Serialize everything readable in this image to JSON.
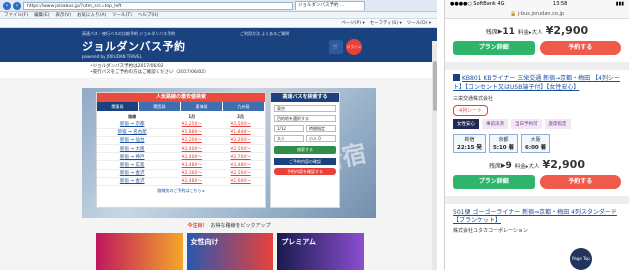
{
  "desktop": {
    "browser": {
      "address": "https://www.jolsabus.jp/?utm_src=top_left",
      "tab_label": "ジョルダンバス予約 ...",
      "menus": [
        "ファイル(F)",
        "編集(E)",
        "表示(V)",
        "お気に入り(A)",
        "ツール(T)",
        "ヘルプ(H)"
      ],
      "commands": [
        "ページ(P) ▾",
        "セーフティ(S) ▾",
        "ツール(O) ▾"
      ]
    },
    "site": {
      "topline": "高速バス・夜行バスの比較予約 ジョルダンバス予約",
      "toplinks": "ご利用方法   よくあるご質問",
      "logo": "ジョルダンバス予約",
      "logo_sub": "powered by JORUDAN TRAVEL",
      "cart": "🛒",
      "login": "ログイン",
      "notices": [
        "ジョルダンバス予約は2017/06/02",
        "夜行バスをご予約の方はご確認ください（2017/06/02）"
      ]
    },
    "hero_text": "新宿",
    "ranking": {
      "title": "人気路線の最安値検索",
      "tabs": [
        "関東発",
        "関西発",
        "東海発",
        "九州発"
      ],
      "headers": [
        "路線",
        "1月",
        "2月"
      ],
      "rows": [
        [
          "新宿 ⇒ 京都",
          "¥2,250〜",
          "¥2,500〜"
        ],
        [
          "新宿 ⇒ 名古屋",
          "¥1,880〜",
          "¥1,848〜"
        ],
        [
          "新宿 ⇒ 仙台",
          "¥2,200〜",
          "¥2,200〜"
        ],
        [
          "新宿 ⇒ 大阪",
          "¥2,400〜",
          "¥2,500〜"
        ],
        [
          "新宿 ⇒ 神戸",
          "¥2,400〜",
          "¥2,700〜"
        ],
        [
          "新宿 ⇒ 広島",
          "¥3,480〜",
          "¥3,480〜"
        ],
        [
          "新宿 ⇒ 金沢",
          "¥2,360〜",
          "¥2,500〜"
        ],
        [
          "新宿 ⇒ 金沢",
          "¥2,480〜",
          "¥2,600〜"
        ]
      ],
      "more": "路線別のご予約はこちら ▸"
    },
    "search": {
      "title": "高速バスを検索する",
      "from": "東京",
      "to": "目的地を選択する",
      "date": "1/12",
      "time": "時間指定",
      "adults": "大人",
      "children": "小人 0",
      "button": "検索する",
      "link1": "ご予約内容の確認",
      "link2": "予約内容を確認する"
    },
    "pickup": {
      "badge": "今注目！",
      "text": "お得な路線をピックアップ"
    },
    "banners": [
      "",
      "女性向け",
      "プレミアム"
    ]
  },
  "mobile": {
    "status": {
      "carrier": "●●●●○ SoftBank  4G",
      "time": "13:58",
      "battery": "▮▮▮"
    },
    "url": "🔒 j-bus.jorudan.co.jp",
    "card1": {
      "remain_label": "残席",
      "remain_value": "▸11",
      "fare_label": "料金▸大人",
      "fare": "¥2,900",
      "detail_button": "プラン詳細",
      "reserve_button": "予約する"
    },
    "card2": {
      "title": "KB801  KBライナー 三栄交通  新宿→京都・梅田  【4列シート】【コンセント又はUSB端子付】【女性安心】",
      "company": "三栄交通株式会社",
      "seat": "4列シート",
      "tags": [
        "女性安心",
        "事前決済",
        "当日予約可"
      ],
      "tag_extra": "座席指定",
      "stops": [
        {
          "station": "新宿",
          "time": "22:15 発"
        },
        {
          "station": "京都",
          "time": "5:10 着"
        },
        {
          "station": "大阪",
          "time": "6:00 着"
        }
      ],
      "remain_label": "残席",
      "remain_value": "▸9",
      "fare_label": "料金▸大人",
      "fare": "¥2,900",
      "detail_button": "プラン詳細",
      "reserve_button": "予約する"
    },
    "card3": {
      "title": "501便  ゴーゴーライナー  新宿⇒京都・梅田  4列スタンダード【ブランケット】",
      "company": "株式会社ユタカコーポレーション"
    },
    "pagetop": "Page Top"
  },
  "colors": {
    "brand_navy": "#19427f",
    "accent_red": "#e8413a",
    "green": "#2fb56b"
  }
}
